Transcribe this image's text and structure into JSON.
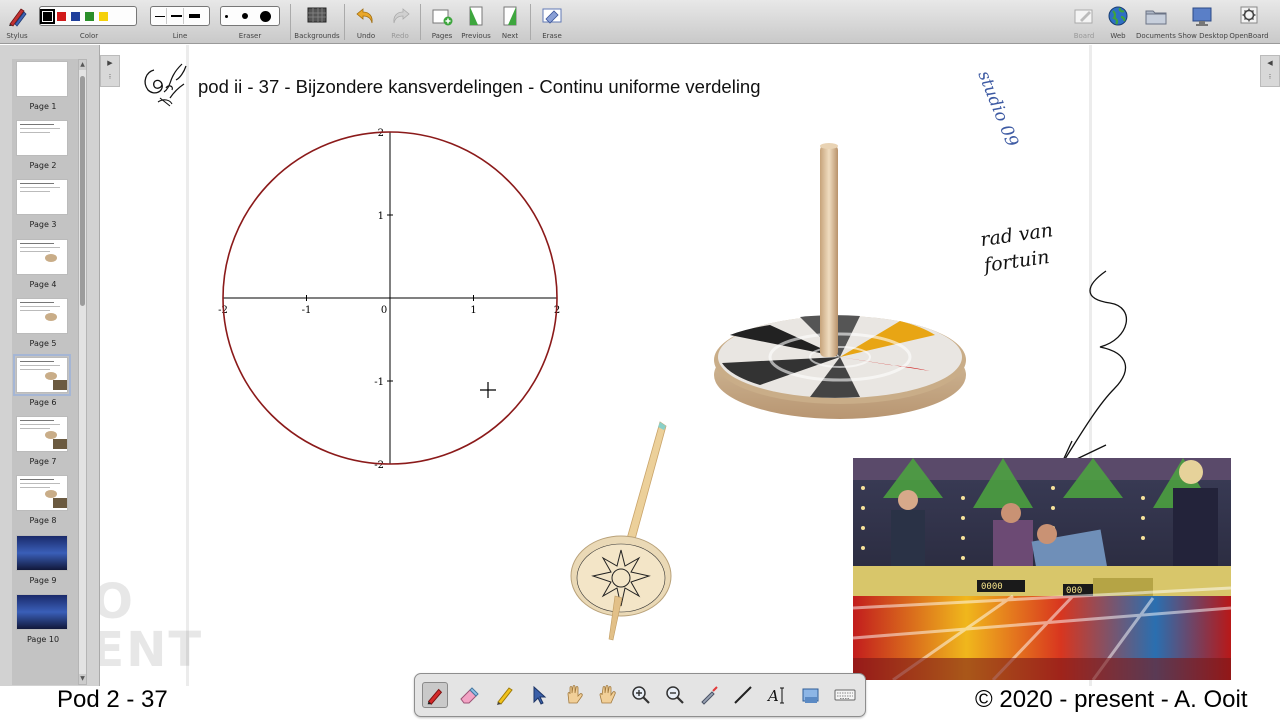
{
  "toolbar": {
    "stylus": "Stylus",
    "color": "Color",
    "line": "Line",
    "eraser": "Eraser",
    "backgrounds": "Backgrounds",
    "undo": "Undo",
    "redo": "Redo",
    "pages": "Pages",
    "previous": "Previous",
    "next": "Next",
    "erase": "Erase",
    "board": "Board",
    "web": "Web",
    "documents": "Documents",
    "show_desktop": "Show Desktop",
    "openboard": "OpenBoard",
    "colors": [
      "#000000",
      "#d11a1a",
      "#1f3f9b",
      "#2a8f2a",
      "#f5d10a"
    ],
    "selected_color_index": 0
  },
  "pages": {
    "items": [
      {
        "label": "Page 1"
      },
      {
        "label": "Page 2"
      },
      {
        "label": "Page 3"
      },
      {
        "label": "Page 4"
      },
      {
        "label": "Page 5"
      },
      {
        "label": "Page 6"
      },
      {
        "label": "Page 7"
      },
      {
        "label": "Page 8"
      },
      {
        "label": "Page 9"
      },
      {
        "label": "Page 10"
      }
    ],
    "selected_index": 5
  },
  "board": {
    "title": "pod ii - 37 - Bijzondere kansverdelingen - Continu uniforme verdeling",
    "studio_text": "studio 09",
    "note_line1": "rad van",
    "note_line2": "fortuin",
    "watermark_line1": "HO",
    "watermark_line2": "GENT"
  },
  "chart_data": {
    "type": "line",
    "title": "",
    "xlabel": "",
    "ylabel": "",
    "xlim": [
      -2,
      2
    ],
    "ylim": [
      -2,
      2
    ],
    "xticks": [
      "-2",
      "-1",
      "0",
      "1",
      "2"
    ],
    "yticks": [
      "-2",
      "-1",
      "1",
      "2"
    ],
    "series": [
      {
        "shape": "circle",
        "center": [
          0,
          0
        ],
        "radius": 2,
        "color": "#8b1a1a"
      }
    ]
  },
  "footer": {
    "left": "Pod 2 - 37",
    "right": "© 2020 - present - A. Ooit"
  }
}
